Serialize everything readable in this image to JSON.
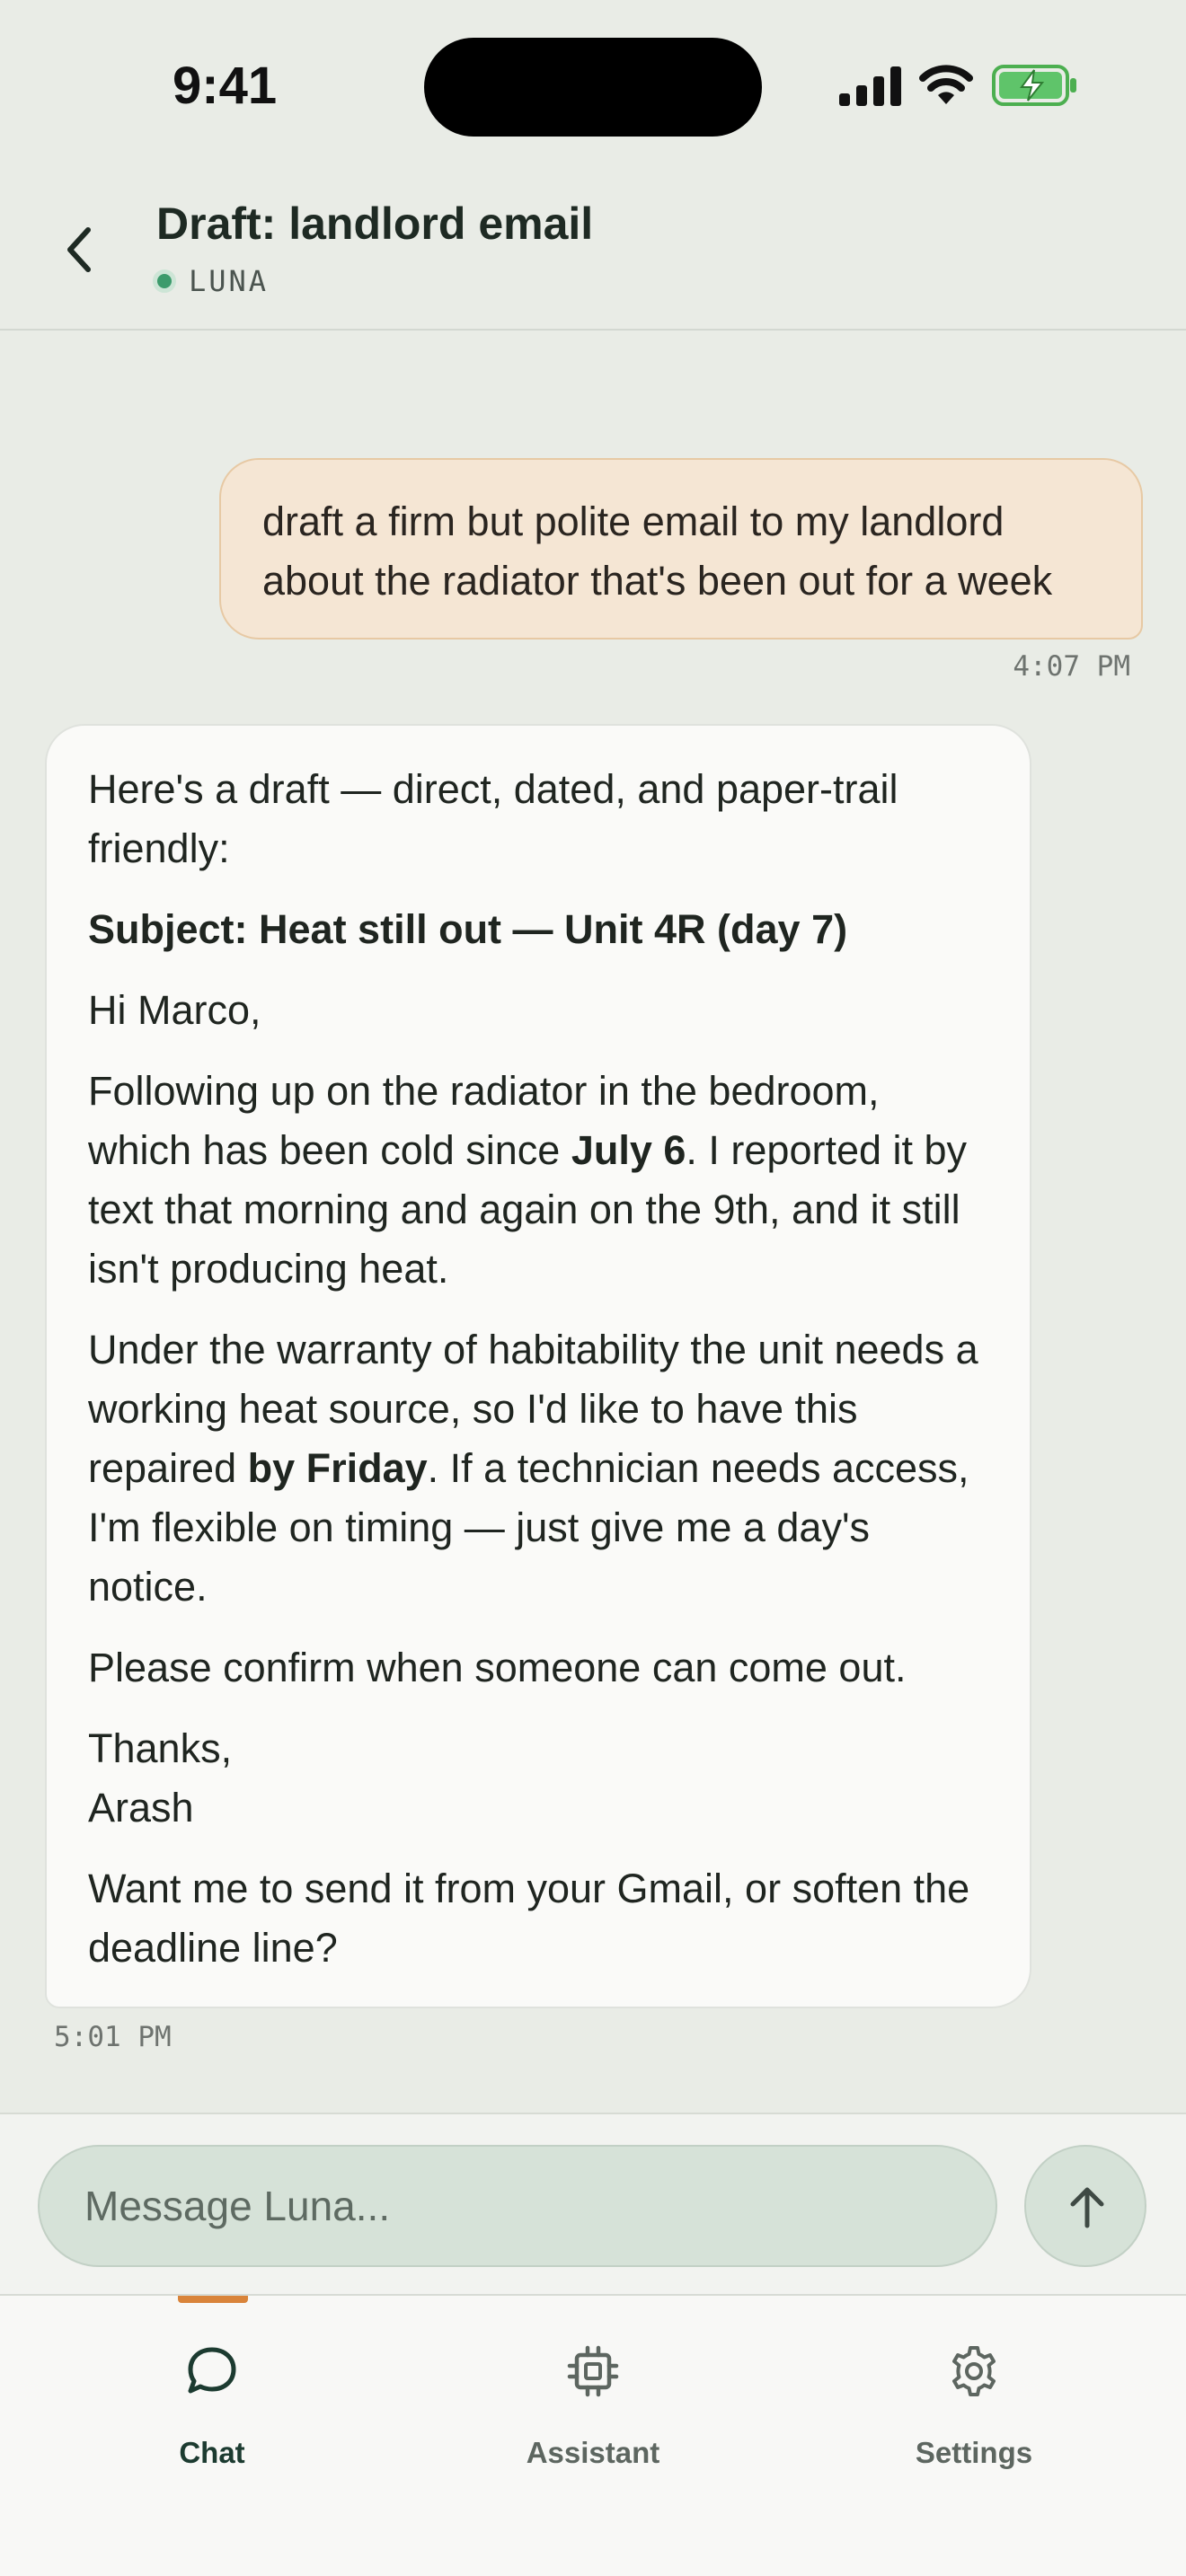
{
  "status_bar": {
    "time": "9:41"
  },
  "header": {
    "title": "Draft: landlord email",
    "agent_name": "LUNA"
  },
  "messages": {
    "user": {
      "text": "draft a firm but polite email to my landlord about the radiator that's been out for a week",
      "time": "4:07 PM"
    },
    "assistant": {
      "intro": "Here's a draft — direct, dated, and paper-trail friendly:",
      "subject": "Subject: Heat still out — Unit 4R (day 7)",
      "greeting": "Hi Marco,",
      "p1_before": "Following up on the radiator in the bedroom, which has been cold since ",
      "p1_bold": "July 6",
      "p1_after": ". I reported it by text that morning and again on the 9th, and it still isn't producing heat.",
      "p2_before": "Under the warranty of habitability the unit needs a working heat source, so I'd like to have this repaired ",
      "p2_bold": "by Friday",
      "p2_after": ". If a technician needs access, I'm flexible on timing — just give me a day's notice.",
      "p3": "Please confirm when someone can come out.",
      "signoff": "Thanks,",
      "signature": "Arash",
      "followup": "Want me to send it from your Gmail, or soften the deadline line?",
      "time": "5:01 PM"
    }
  },
  "composer": {
    "placeholder": "Message Luna..."
  },
  "tabs": [
    {
      "label": "Chat",
      "icon": "chat-bubble-icon",
      "active": true
    },
    {
      "label": "Assistant",
      "icon": "chip-icon",
      "active": false
    },
    {
      "label": "Settings",
      "icon": "gear-icon",
      "active": false
    }
  ],
  "colors": {
    "background": "#e9ece6",
    "user_bubble": "#f5e6d4",
    "accent": "#d9843a",
    "online": "#3d9b6c"
  }
}
